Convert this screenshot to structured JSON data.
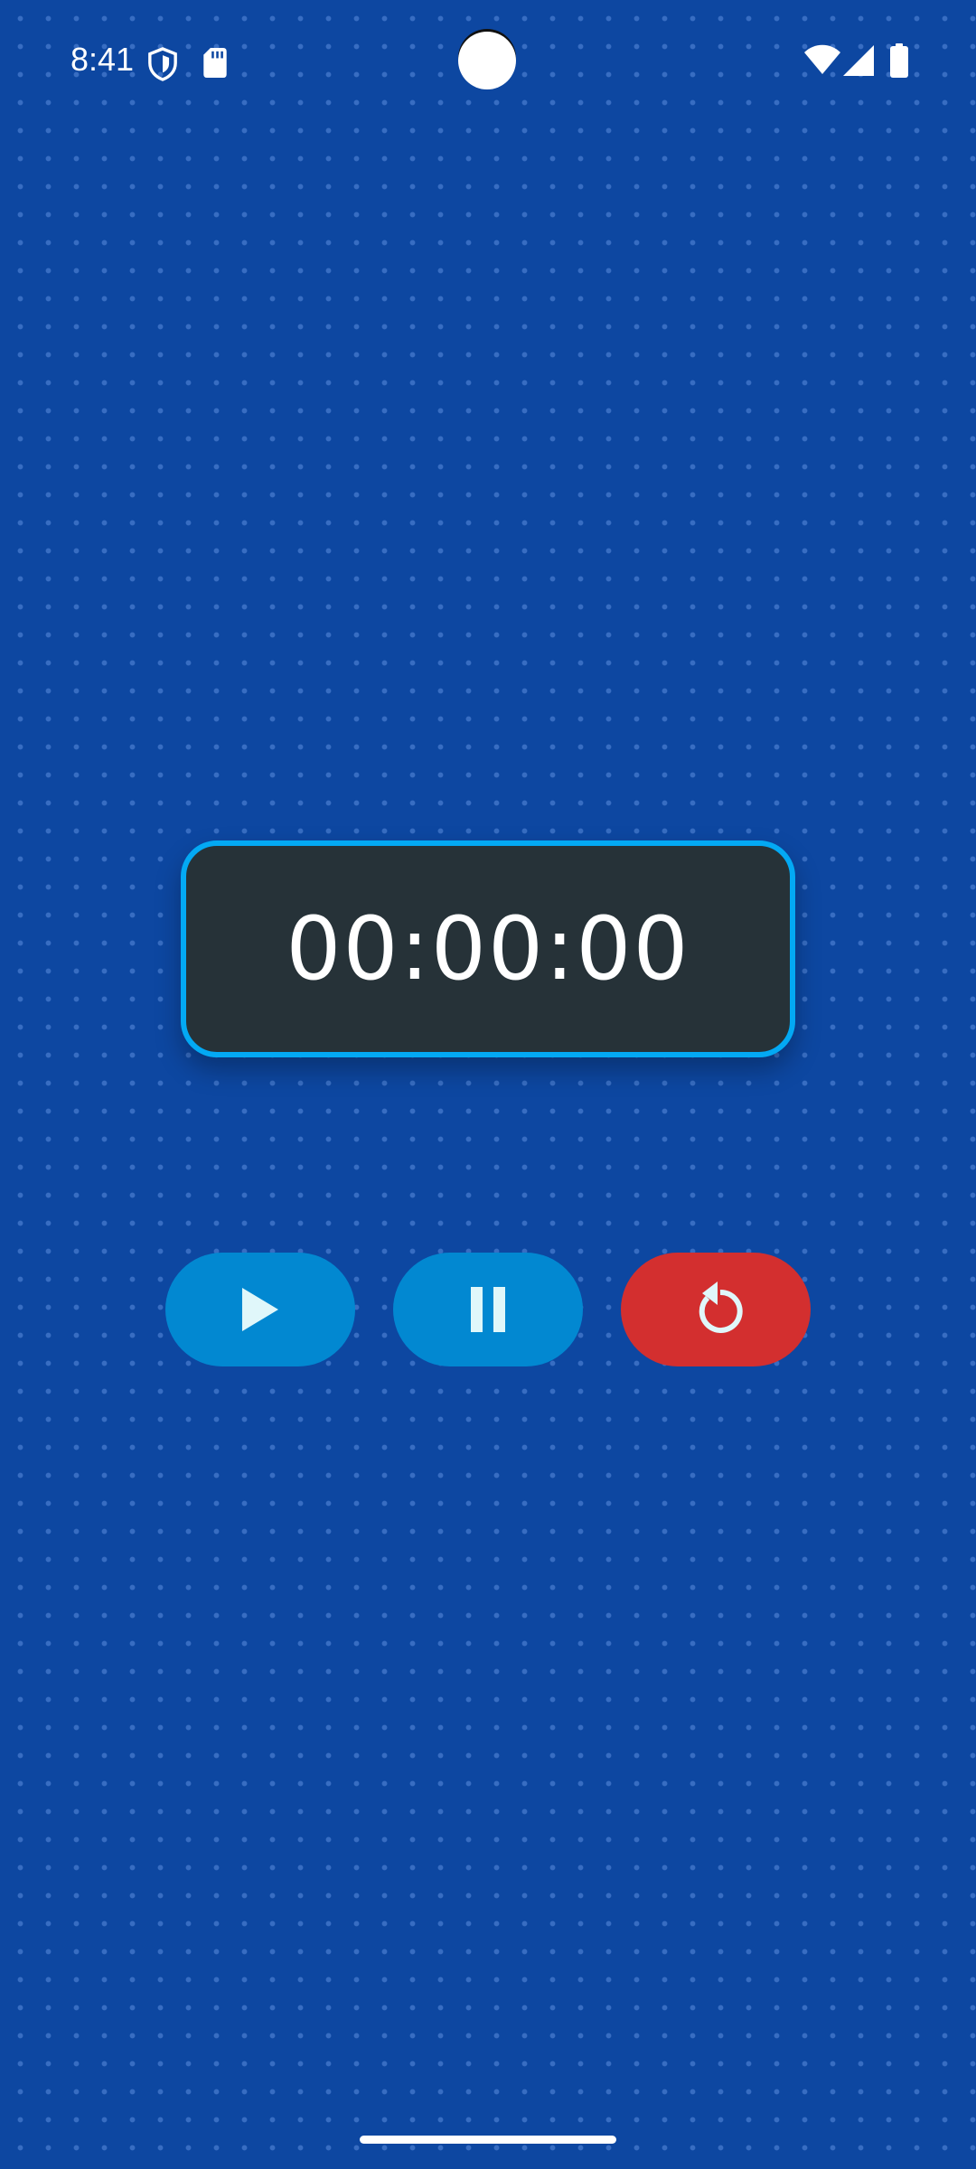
{
  "status_bar": {
    "time": "8:41",
    "icons": [
      "shield-icon",
      "sd-card-icon",
      "wifi-icon",
      "cell-signal-icon",
      "battery-icon"
    ]
  },
  "timer": {
    "display": "00:00:00"
  },
  "controls": [
    {
      "name": "play",
      "icon": "play-icon",
      "color": "#0288d1"
    },
    {
      "name": "pause",
      "icon": "pause-icon",
      "color": "#0288d1"
    },
    {
      "name": "reset",
      "icon": "reset-icon",
      "color": "#d32f2f"
    }
  ],
  "colors": {
    "background": "#0d47a1",
    "timer_card": "#263238",
    "timer_border": "#03a9f4",
    "icon_tint": "#e0f7fa"
  }
}
